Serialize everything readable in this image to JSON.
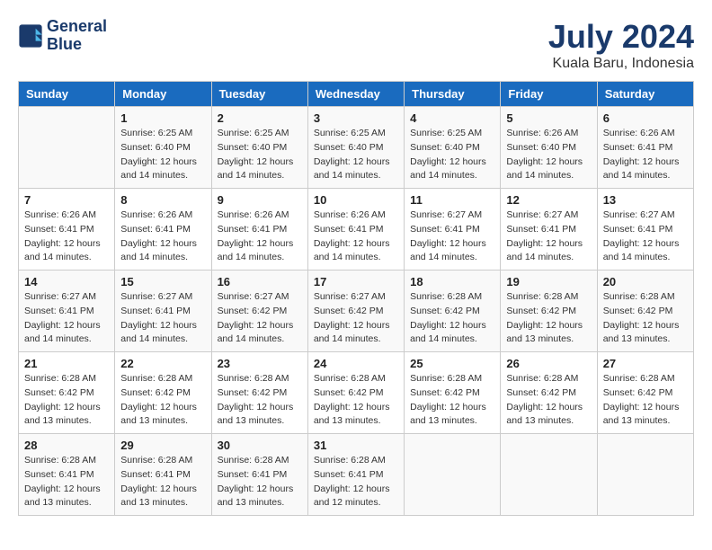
{
  "header": {
    "logo_line1": "General",
    "logo_line2": "Blue",
    "month_year": "July 2024",
    "location": "Kuala Baru, Indonesia"
  },
  "days_of_week": [
    "Sunday",
    "Monday",
    "Tuesday",
    "Wednesday",
    "Thursday",
    "Friday",
    "Saturday"
  ],
  "weeks": [
    [
      {
        "day": "",
        "sunrise": "",
        "sunset": "",
        "daylight": ""
      },
      {
        "day": "1",
        "sunrise": "Sunrise: 6:25 AM",
        "sunset": "Sunset: 6:40 PM",
        "daylight": "Daylight: 12 hours and 14 minutes."
      },
      {
        "day": "2",
        "sunrise": "Sunrise: 6:25 AM",
        "sunset": "Sunset: 6:40 PM",
        "daylight": "Daylight: 12 hours and 14 minutes."
      },
      {
        "day": "3",
        "sunrise": "Sunrise: 6:25 AM",
        "sunset": "Sunset: 6:40 PM",
        "daylight": "Daylight: 12 hours and 14 minutes."
      },
      {
        "day": "4",
        "sunrise": "Sunrise: 6:25 AM",
        "sunset": "Sunset: 6:40 PM",
        "daylight": "Daylight: 12 hours and 14 minutes."
      },
      {
        "day": "5",
        "sunrise": "Sunrise: 6:26 AM",
        "sunset": "Sunset: 6:40 PM",
        "daylight": "Daylight: 12 hours and 14 minutes."
      },
      {
        "day": "6",
        "sunrise": "Sunrise: 6:26 AM",
        "sunset": "Sunset: 6:41 PM",
        "daylight": "Daylight: 12 hours and 14 minutes."
      }
    ],
    [
      {
        "day": "7",
        "sunrise": "Sunrise: 6:26 AM",
        "sunset": "Sunset: 6:41 PM",
        "daylight": "Daylight: 12 hours and 14 minutes."
      },
      {
        "day": "8",
        "sunrise": "Sunrise: 6:26 AM",
        "sunset": "Sunset: 6:41 PM",
        "daylight": "Daylight: 12 hours and 14 minutes."
      },
      {
        "day": "9",
        "sunrise": "Sunrise: 6:26 AM",
        "sunset": "Sunset: 6:41 PM",
        "daylight": "Daylight: 12 hours and 14 minutes."
      },
      {
        "day": "10",
        "sunrise": "Sunrise: 6:26 AM",
        "sunset": "Sunset: 6:41 PM",
        "daylight": "Daylight: 12 hours and 14 minutes."
      },
      {
        "day": "11",
        "sunrise": "Sunrise: 6:27 AM",
        "sunset": "Sunset: 6:41 PM",
        "daylight": "Daylight: 12 hours and 14 minutes."
      },
      {
        "day": "12",
        "sunrise": "Sunrise: 6:27 AM",
        "sunset": "Sunset: 6:41 PM",
        "daylight": "Daylight: 12 hours and 14 minutes."
      },
      {
        "day": "13",
        "sunrise": "Sunrise: 6:27 AM",
        "sunset": "Sunset: 6:41 PM",
        "daylight": "Daylight: 12 hours and 14 minutes."
      }
    ],
    [
      {
        "day": "14",
        "sunrise": "Sunrise: 6:27 AM",
        "sunset": "Sunset: 6:41 PM",
        "daylight": "Daylight: 12 hours and 14 minutes."
      },
      {
        "day": "15",
        "sunrise": "Sunrise: 6:27 AM",
        "sunset": "Sunset: 6:41 PM",
        "daylight": "Daylight: 12 hours and 14 minutes."
      },
      {
        "day": "16",
        "sunrise": "Sunrise: 6:27 AM",
        "sunset": "Sunset: 6:42 PM",
        "daylight": "Daylight: 12 hours and 14 minutes."
      },
      {
        "day": "17",
        "sunrise": "Sunrise: 6:27 AM",
        "sunset": "Sunset: 6:42 PM",
        "daylight": "Daylight: 12 hours and 14 minutes."
      },
      {
        "day": "18",
        "sunrise": "Sunrise: 6:28 AM",
        "sunset": "Sunset: 6:42 PM",
        "daylight": "Daylight: 12 hours and 14 minutes."
      },
      {
        "day": "19",
        "sunrise": "Sunrise: 6:28 AM",
        "sunset": "Sunset: 6:42 PM",
        "daylight": "Daylight: 12 hours and 13 minutes."
      },
      {
        "day": "20",
        "sunrise": "Sunrise: 6:28 AM",
        "sunset": "Sunset: 6:42 PM",
        "daylight": "Daylight: 12 hours and 13 minutes."
      }
    ],
    [
      {
        "day": "21",
        "sunrise": "Sunrise: 6:28 AM",
        "sunset": "Sunset: 6:42 PM",
        "daylight": "Daylight: 12 hours and 13 minutes."
      },
      {
        "day": "22",
        "sunrise": "Sunrise: 6:28 AM",
        "sunset": "Sunset: 6:42 PM",
        "daylight": "Daylight: 12 hours and 13 minutes."
      },
      {
        "day": "23",
        "sunrise": "Sunrise: 6:28 AM",
        "sunset": "Sunset: 6:42 PM",
        "daylight": "Daylight: 12 hours and 13 minutes."
      },
      {
        "day": "24",
        "sunrise": "Sunrise: 6:28 AM",
        "sunset": "Sunset: 6:42 PM",
        "daylight": "Daylight: 12 hours and 13 minutes."
      },
      {
        "day": "25",
        "sunrise": "Sunrise: 6:28 AM",
        "sunset": "Sunset: 6:42 PM",
        "daylight": "Daylight: 12 hours and 13 minutes."
      },
      {
        "day": "26",
        "sunrise": "Sunrise: 6:28 AM",
        "sunset": "Sunset: 6:42 PM",
        "daylight": "Daylight: 12 hours and 13 minutes."
      },
      {
        "day": "27",
        "sunrise": "Sunrise: 6:28 AM",
        "sunset": "Sunset: 6:42 PM",
        "daylight": "Daylight: 12 hours and 13 minutes."
      }
    ],
    [
      {
        "day": "28",
        "sunrise": "Sunrise: 6:28 AM",
        "sunset": "Sunset: 6:41 PM",
        "daylight": "Daylight: 12 hours and 13 minutes."
      },
      {
        "day": "29",
        "sunrise": "Sunrise: 6:28 AM",
        "sunset": "Sunset: 6:41 PM",
        "daylight": "Daylight: 12 hours and 13 minutes."
      },
      {
        "day": "30",
        "sunrise": "Sunrise: 6:28 AM",
        "sunset": "Sunset: 6:41 PM",
        "daylight": "Daylight: 12 hours and 13 minutes."
      },
      {
        "day": "31",
        "sunrise": "Sunrise: 6:28 AM",
        "sunset": "Sunset: 6:41 PM",
        "daylight": "Daylight: 12 hours and 12 minutes."
      },
      {
        "day": "",
        "sunrise": "",
        "sunset": "",
        "daylight": ""
      },
      {
        "day": "",
        "sunrise": "",
        "sunset": "",
        "daylight": ""
      },
      {
        "day": "",
        "sunrise": "",
        "sunset": "",
        "daylight": ""
      }
    ]
  ]
}
